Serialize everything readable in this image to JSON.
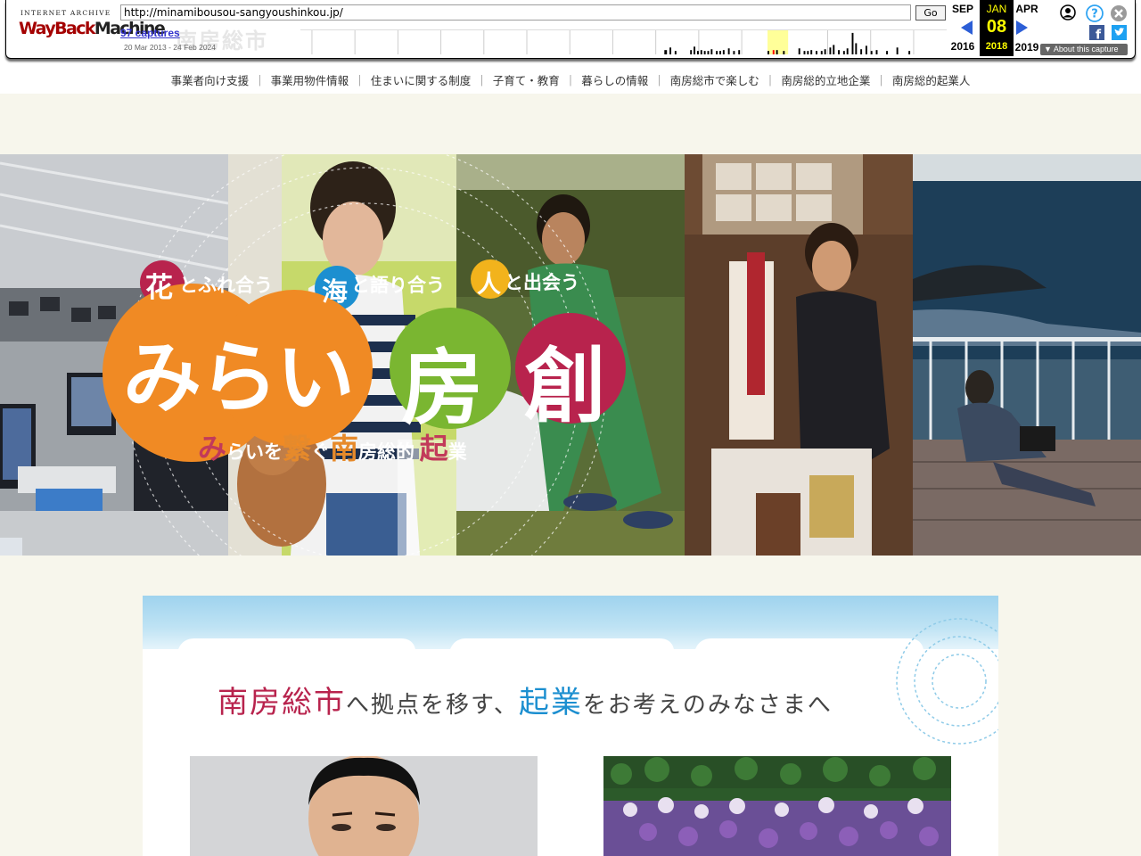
{
  "wayback": {
    "logo_top": "INTERNET ARCHIVE",
    "logo_wayback": "WayBack",
    "logo_machine": "Machine",
    "url": "http://minamibousou-sangyoushinkou.jp/",
    "go_label": "Go",
    "captures": "97 captures",
    "range": "20 Mar 2013 - 24 Feb 2024",
    "prev_month": "SEP",
    "prev_year": "2016",
    "cur_month": "JAN",
    "cur_day": "08",
    "cur_year": "2018",
    "next_month": "APR",
    "next_year": "2019",
    "about": "About this capture"
  },
  "ghost_title": "南房総市",
  "nav": {
    "items": [
      "事業者向け支援",
      "事業用物件情報",
      "住まいに関する制度",
      "子育て・教育",
      "暮らしの情報",
      "南房総市で楽しむ",
      "南房総的立地企業",
      "南房総的起業人"
    ],
    "separator": "｜"
  },
  "hero": {
    "tagline_1_big": "花",
    "tagline_1_rest": "とふれ合う",
    "tagline_2_big": "海",
    "tagline_2_rest": "と語り合う",
    "tagline_3_big": "人",
    "tagline_3_rest": "と出会う",
    "logo_1": "みらい",
    "logo_2": "房",
    "logo_3": "創",
    "sub_1": "み",
    "sub_2": "らいを",
    "sub_3": "繋",
    "sub_4": "ぐ",
    "sub_5": "南",
    "sub_6": "房総的",
    "sub_7": "起",
    "sub_8": "業"
  },
  "intro": {
    "head_red": "南房総市",
    "head_mid": "へ拠点を移す、",
    "head_blue": "起業",
    "head_end": "をお考えのみなさまへ"
  },
  "colors": {
    "accent_red": "#b8234d",
    "accent_blue": "#1c8fd0",
    "accent_orange": "#f08a24",
    "accent_green": "#7ab631",
    "bg_cream": "#f7f6ec"
  }
}
